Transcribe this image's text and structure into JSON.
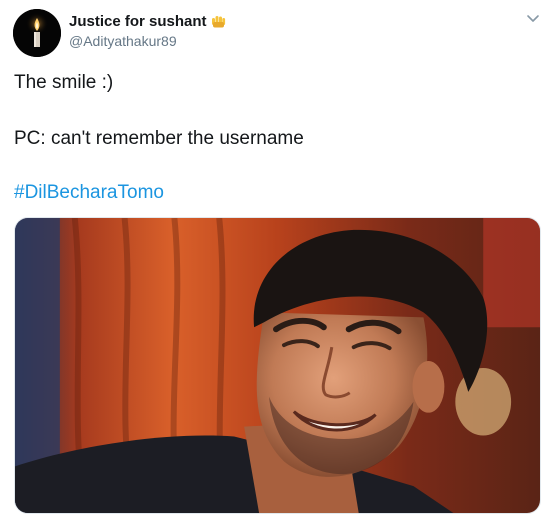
{
  "tweet": {
    "author": {
      "display_name": "Justice for sushant",
      "handle": "@Adityathakur89",
      "badge_icon": "raised-fist-emoji",
      "avatar_icon": "candle-flame"
    },
    "text_lines": [
      "The smile :)",
      "PC: can't remember the username"
    ],
    "hashtag": "#DilBecharaTomo",
    "menu_icon": "chevron-down-icon",
    "media_icon": "smiling-man-photo"
  },
  "colors": {
    "name": "#14171a",
    "handle": "#657786",
    "hashtag": "#1b95e0",
    "badge": "#f5c33b"
  }
}
